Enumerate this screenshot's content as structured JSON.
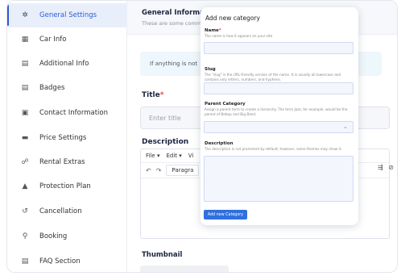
{
  "sidebar": {
    "items": [
      {
        "label": "General Settings",
        "icon": "gear-icon",
        "glyph": "✲",
        "active": true
      },
      {
        "label": "Car Info",
        "icon": "calendar-icon",
        "glyph": "▦"
      },
      {
        "label": "Additional Info",
        "icon": "clipboard-icon",
        "glyph": "▤"
      },
      {
        "label": "Badges",
        "icon": "clipboard-icon",
        "glyph": "▤"
      },
      {
        "label": "Contact Information",
        "icon": "contact-card-icon",
        "glyph": "▣"
      },
      {
        "label": "Price Settings",
        "icon": "money-icon",
        "glyph": "▬"
      },
      {
        "label": "Rental Extras",
        "icon": "extras-icon",
        "glyph": "☍"
      },
      {
        "label": "Protection Plan",
        "icon": "lock-icon",
        "glyph": "▲"
      },
      {
        "label": "Cancellation",
        "icon": "undo-icon",
        "glyph": "↺"
      },
      {
        "label": "Booking",
        "icon": "person-walk-icon",
        "glyph": "⚲"
      },
      {
        "label": "FAQ Section",
        "icon": "clipboard-icon",
        "glyph": "▤"
      }
    ]
  },
  "main": {
    "section_title": "General Informatio",
    "section_subtitle": "These are some comm",
    "info_text": "If anything is not",
    "title_label": "Title",
    "required_mark": "*",
    "title_placeholder": "Enter title",
    "description_label": "Description",
    "editor_menu": [
      "File ▾",
      "Edit ▾",
      "Vi"
    ],
    "paragraph_label": "Paragra",
    "thumbnail_label": "Thumbnail"
  },
  "modal": {
    "title": "Add new category",
    "name_label": "Name",
    "name_required": "*",
    "name_help": "The name is how it appears on your site.",
    "slug_label": "Slug",
    "slug_help": "The \"slug\" is the URL-friendly version of the name. It is usually all lowercase and contains only letters, numbers, and hyphens.",
    "parent_label": "Parent Category",
    "parent_help": "Assign a parent term to create a hierarchy. The term Jazz, for example, would be the parent of Bebop and Big Band.",
    "description_label": "Description",
    "description_help": "The description is not prominent by default; however, some themes may show it.",
    "submit_label": "Add new Category"
  }
}
